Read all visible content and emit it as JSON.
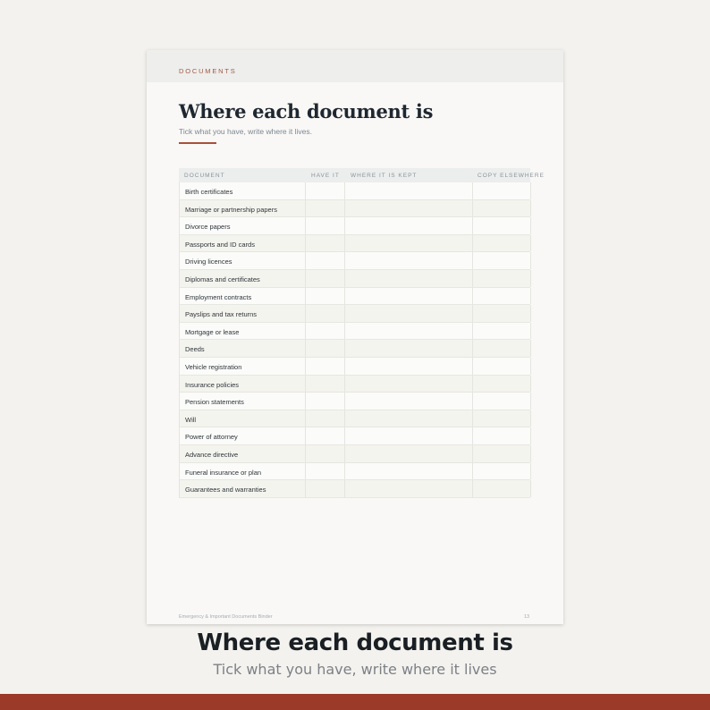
{
  "page": {
    "section_label": "DOCUMENTS",
    "title": "Where each document is",
    "subtitle": "Tick what you have, write where it lives.",
    "footer_left": "Emergency & Important Documents Binder",
    "footer_right": "13"
  },
  "table": {
    "headers": [
      "DOCUMENT",
      "HAVE IT",
      "WHERE IT IS KEPT",
      "COPY ELSEWHERE"
    ],
    "rows": [
      "Birth certificates",
      "Marriage or partnership papers",
      "Divorce papers",
      "Passports and ID cards",
      "Driving licences",
      "Diplomas and certificates",
      "Employment contracts",
      "Payslips and tax returns",
      "Mortgage or lease",
      "Deeds",
      "Vehicle registration",
      "Insurance policies",
      "Pension statements",
      "Will",
      "Power of attorney",
      "Advance directive",
      "Funeral insurance or plan",
      "Guarantees and warranties"
    ]
  },
  "caption": {
    "title": "Where each document is",
    "subtitle": "Tick what you have, write where it lives"
  },
  "colors": {
    "accent": "#a8513c",
    "band": "#9b3a29",
    "title": "#1f2730"
  }
}
